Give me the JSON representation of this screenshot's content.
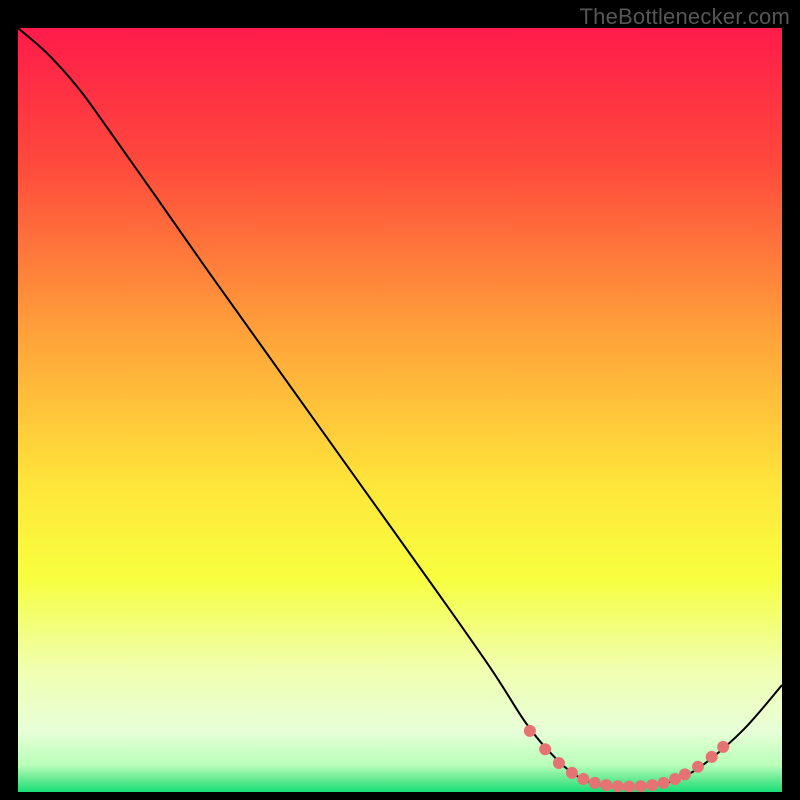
{
  "watermark": "TheBottlenecker.com",
  "chart_data": {
    "type": "line",
    "title": "",
    "xlabel": "",
    "ylabel": "",
    "xlim": [
      0,
      100
    ],
    "ylim": [
      0,
      100
    ],
    "gradient_stops": [
      {
        "offset": 0.0,
        "color": "#ff1b4a"
      },
      {
        "offset": 0.18,
        "color": "#ff4a3c"
      },
      {
        "offset": 0.4,
        "color": "#ffa23a"
      },
      {
        "offset": 0.6,
        "color": "#ffe63a"
      },
      {
        "offset": 0.72,
        "color": "#f7ff3f"
      },
      {
        "offset": 0.84,
        "color": "#f0ffb0"
      },
      {
        "offset": 0.92,
        "color": "#e8ffd8"
      },
      {
        "offset": 0.965,
        "color": "#b8ffb8"
      },
      {
        "offset": 0.985,
        "color": "#5fe88f"
      },
      {
        "offset": 1.0,
        "color": "#17df78"
      }
    ],
    "series": [
      {
        "name": "curve",
        "type": "line",
        "color": "#000000",
        "width": 2,
        "points": [
          {
            "x": 0.0,
            "y": 100.0
          },
          {
            "x": 4.0,
            "y": 96.5
          },
          {
            "x": 8.0,
            "y": 92.0
          },
          {
            "x": 12.0,
            "y": 86.5
          },
          {
            "x": 18.0,
            "y": 78.0
          },
          {
            "x": 25.0,
            "y": 68.0
          },
          {
            "x": 35.0,
            "y": 54.0
          },
          {
            "x": 45.0,
            "y": 40.0
          },
          {
            "x": 55.0,
            "y": 26.0
          },
          {
            "x": 62.0,
            "y": 16.0
          },
          {
            "x": 66.5,
            "y": 9.0
          },
          {
            "x": 70.0,
            "y": 4.8
          },
          {
            "x": 73.0,
            "y": 2.2
          },
          {
            "x": 76.0,
            "y": 1.0
          },
          {
            "x": 80.0,
            "y": 0.7
          },
          {
            "x": 84.0,
            "y": 1.0
          },
          {
            "x": 87.0,
            "y": 2.0
          },
          {
            "x": 90.0,
            "y": 3.8
          },
          {
            "x": 95.0,
            "y": 8.2
          },
          {
            "x": 100.0,
            "y": 14.0
          }
        ]
      },
      {
        "name": "markers",
        "type": "scatter",
        "color": "#e57373",
        "radius": 6,
        "points": [
          {
            "x": 67.0,
            "y": 8.0
          },
          {
            "x": 69.0,
            "y": 5.6
          },
          {
            "x": 70.8,
            "y": 3.8
          },
          {
            "x": 72.5,
            "y": 2.5
          },
          {
            "x": 74.0,
            "y": 1.7
          },
          {
            "x": 75.5,
            "y": 1.2
          },
          {
            "x": 77.0,
            "y": 0.9
          },
          {
            "x": 78.5,
            "y": 0.75
          },
          {
            "x": 80.0,
            "y": 0.7
          },
          {
            "x": 81.5,
            "y": 0.75
          },
          {
            "x": 83.0,
            "y": 0.9
          },
          {
            "x": 84.5,
            "y": 1.2
          },
          {
            "x": 86.0,
            "y": 1.7
          },
          {
            "x": 87.3,
            "y": 2.3
          },
          {
            "x": 89.0,
            "y": 3.3
          },
          {
            "x": 90.8,
            "y": 4.6
          },
          {
            "x": 92.3,
            "y": 5.9
          }
        ]
      }
    ]
  }
}
